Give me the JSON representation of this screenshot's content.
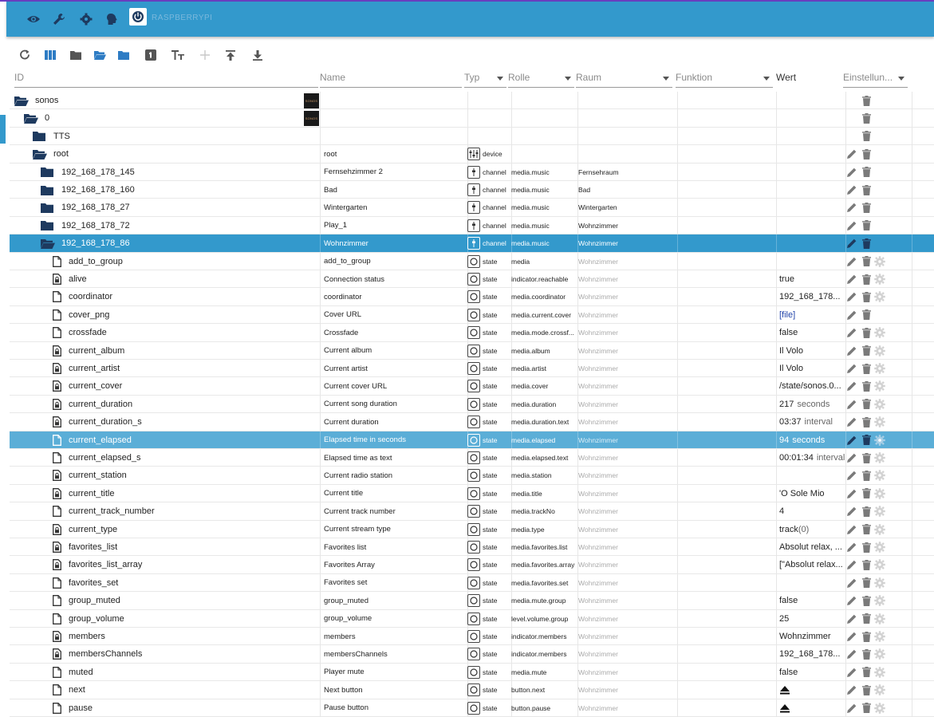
{
  "topbar": {
    "brand": "RASPBERRYPI",
    "icons": [
      "eye-icon",
      "wrench-icon",
      "gear-icon",
      "head-icon",
      "power-icon"
    ]
  },
  "toolbar": {
    "tools": [
      "refresh-icon",
      "columns-icon",
      "folder-icon",
      "folder-open-icon",
      "folder-icon",
      "number-1-icon",
      "text-size-icon",
      "plus-icon",
      "upload-icon",
      "download-icon"
    ]
  },
  "columns": {
    "id": "ID",
    "name": "Name",
    "typ": "Typ",
    "rolle": "Rolle",
    "raum": "Raum",
    "funktion": "Funktion",
    "wert": "Wert",
    "einstellungen": "Einstellun..."
  },
  "colors": {
    "topbar": "#3399cc",
    "selected": "#3399cc",
    "highlight": "#5baed7",
    "accent": "#6a3fc0"
  },
  "rows": [
    {
      "indent": 0,
      "icon": "folder-open",
      "id": "sonos",
      "name": "",
      "logo": true,
      "logo_text": "SONOS",
      "type": "",
      "type_icon": "",
      "role": "",
      "room": "",
      "wert": "",
      "actions": "d"
    },
    {
      "indent": 1,
      "icon": "folder-open",
      "id": "0",
      "name": "",
      "logo": true,
      "logo_text": "SONOS",
      "type": "",
      "type_icon": "",
      "role": "",
      "room": "",
      "wert": "",
      "actions": "d"
    },
    {
      "indent": 2,
      "icon": "folder",
      "id": "TTS",
      "name": "",
      "type": "",
      "type_icon": "",
      "role": "",
      "room": "",
      "wert": "",
      "actions": "d"
    },
    {
      "indent": 2,
      "icon": "folder-open",
      "id": "root",
      "name": "root",
      "type": "device",
      "type_icon": "device",
      "role": "",
      "room": "",
      "wert": "",
      "actions": "ed"
    },
    {
      "indent": 3,
      "icon": "folder",
      "id": "192_168_178_145",
      "name": "Fernsehzimmer 2",
      "type": "channel",
      "type_icon": "channel",
      "role": "media.music",
      "room": "Fernsehraum",
      "wert": "",
      "actions": "ed"
    },
    {
      "indent": 3,
      "icon": "folder",
      "id": "192_168_178_160",
      "name": "Bad",
      "type": "channel",
      "type_icon": "channel",
      "role": "media.music",
      "room": "Bad",
      "wert": "",
      "actions": "ed"
    },
    {
      "indent": 3,
      "icon": "folder",
      "id": "192_168_178_27",
      "name": "Wintergarten",
      "type": "channel",
      "type_icon": "channel",
      "role": "media.music",
      "room": "Wintergarten",
      "wert": "",
      "actions": "ed"
    },
    {
      "indent": 3,
      "icon": "folder",
      "id": "192_168_178_72",
      "name": "Play_1",
      "type": "channel",
      "type_icon": "channel",
      "role": "media.music",
      "room": "Wohnzimmer",
      "wert": "",
      "actions": "ed"
    },
    {
      "indent": 3,
      "icon": "folder-open",
      "id": "192_168_178_86",
      "name": "Wohnzimmer",
      "type": "channel",
      "type_icon": "channel",
      "role": "media.music",
      "room": "Wohnzimmer",
      "wert": "",
      "actions": "ed",
      "state": "sel"
    },
    {
      "indent": 4,
      "icon": "file",
      "id": "add_to_group",
      "name": "add_to_group",
      "type": "state",
      "type_icon": "state",
      "role": "media",
      "room": "Wohnzimmer",
      "room_grey": true,
      "wert": "",
      "actions": "edg"
    },
    {
      "indent": 4,
      "icon": "file-lock",
      "id": "alive",
      "name": "Connection status",
      "type": "state",
      "type_icon": "state",
      "role": "indicator.reachable",
      "room": "Wohnzimmer",
      "room_grey": true,
      "wert": "true",
      "actions": "edg"
    },
    {
      "indent": 4,
      "icon": "file",
      "id": "coordinator",
      "name": "coordinator",
      "type": "state",
      "type_icon": "state",
      "role": "media.coordinator",
      "room": "Wohnzimmer",
      "room_grey": true,
      "wert": "192_168_178...",
      "actions": "edg"
    },
    {
      "indent": 4,
      "icon": "file",
      "id": "cover_png",
      "name": "Cover URL",
      "type": "state",
      "type_icon": "state",
      "role": "media.current.cover",
      "room": "Wohnzimmer",
      "room_grey": true,
      "wert": "[file]",
      "wert_link": true,
      "actions": "ed"
    },
    {
      "indent": 4,
      "icon": "file",
      "id": "crossfade",
      "name": "Crossfade",
      "type": "state",
      "type_icon": "state",
      "role": "media.mode.crossf...",
      "room": "Wohnzimmer",
      "room_grey": true,
      "wert": "false",
      "actions": "edg"
    },
    {
      "indent": 4,
      "icon": "file-lock",
      "id": "current_album",
      "name": "Current album",
      "type": "state",
      "type_icon": "state",
      "role": "media.album",
      "room": "Wohnzimmer",
      "room_grey": true,
      "wert": "Il Volo",
      "actions": "edg"
    },
    {
      "indent": 4,
      "icon": "file-lock",
      "id": "current_artist",
      "name": "Current artist",
      "type": "state",
      "type_icon": "state",
      "role": "media.artist",
      "room": "Wohnzimmer",
      "room_grey": true,
      "wert": "Il Volo",
      "actions": "edg"
    },
    {
      "indent": 4,
      "icon": "file-lock",
      "id": "current_cover",
      "name": "Current cover URL",
      "type": "state",
      "type_icon": "state",
      "role": "media.cover",
      "room": "Wohnzimmer",
      "room_grey": true,
      "wert": "/state/sonos.0...",
      "actions": "edg"
    },
    {
      "indent": 4,
      "icon": "file-lock",
      "id": "current_duration",
      "name": "Current song duration",
      "type": "state",
      "type_icon": "state",
      "role": "media.duration",
      "room": "Wohnzimmer",
      "room_grey": true,
      "wert": "217",
      "unit": "seconds",
      "actions": "edg"
    },
    {
      "indent": 4,
      "icon": "file-lock",
      "id": "current_duration_s",
      "name": "Current duration",
      "type": "state",
      "type_icon": "state",
      "role": "media.duration.text",
      "room": "Wohnzimmer",
      "room_grey": true,
      "wert": "03:37",
      "unit": "interval",
      "actions": "edg"
    },
    {
      "indent": 4,
      "icon": "file",
      "id": "current_elapsed",
      "name": "Elapsed time in seconds",
      "type": "state",
      "type_icon": "state",
      "role": "media.elapsed",
      "room": "Wohnzimmer",
      "room_grey": true,
      "wert": "94",
      "unit": "seconds",
      "actions": "edg",
      "state": "hl"
    },
    {
      "indent": 4,
      "icon": "file",
      "id": "current_elapsed_s",
      "name": "Elapsed time as text",
      "type": "state",
      "type_icon": "state",
      "role": "media.elapsed.text",
      "room": "Wohnzimmer",
      "room_grey": true,
      "wert": "00:01:34",
      "unit": "interval",
      "actions": "edg"
    },
    {
      "indent": 4,
      "icon": "file-lock",
      "id": "current_station",
      "name": "Current radio station",
      "type": "state",
      "type_icon": "state",
      "role": "media.station",
      "room": "Wohnzimmer",
      "room_grey": true,
      "wert": "",
      "actions": "edg"
    },
    {
      "indent": 4,
      "icon": "file-lock",
      "id": "current_title",
      "name": "Current title",
      "type": "state",
      "type_icon": "state",
      "role": "media.title",
      "room": "Wohnzimmer",
      "room_grey": true,
      "wert": "'O Sole Mio",
      "actions": "edg"
    },
    {
      "indent": 4,
      "icon": "file",
      "id": "current_track_number",
      "name": "Current track number",
      "type": "state",
      "type_icon": "state",
      "role": "media.trackNo",
      "room": "Wohnzimmer",
      "room_grey": true,
      "wert": "4",
      "actions": "edg"
    },
    {
      "indent": 4,
      "icon": "file-lock",
      "id": "current_type",
      "name": "Current stream type",
      "type": "state",
      "type_icon": "state",
      "role": "media.type",
      "room": "Wohnzimmer",
      "room_grey": true,
      "wert": "track",
      "unit": "(0)",
      "unit_tight": true,
      "actions": "edg"
    },
    {
      "indent": 4,
      "icon": "file-lock",
      "id": "favorites_list",
      "name": "Favorites list",
      "type": "state",
      "type_icon": "state",
      "role": "media.favorites.list",
      "room": "Wohnzimmer",
      "room_grey": true,
      "wert": "Absolut relax, ...",
      "actions": "edg"
    },
    {
      "indent": 4,
      "icon": "file-lock",
      "id": "favorites_list_array",
      "name": "Favorites Array",
      "type": "state",
      "type_icon": "state",
      "role": "media.favorites.array",
      "room": "Wohnzimmer",
      "room_grey": true,
      "wert": "[\"Absolut relax...",
      "actions": "edg"
    },
    {
      "indent": 4,
      "icon": "file",
      "id": "favorites_set",
      "name": "Favorites set",
      "type": "state",
      "type_icon": "state",
      "role": "media.favorites.set",
      "room": "Wohnzimmer",
      "room_grey": true,
      "wert": "",
      "actions": "edg"
    },
    {
      "indent": 4,
      "icon": "file",
      "id": "group_muted",
      "name": "group_muted",
      "type": "state",
      "type_icon": "state",
      "role": "media.mute.group",
      "room": "Wohnzimmer",
      "room_grey": true,
      "wert": "false",
      "actions": "edg"
    },
    {
      "indent": 4,
      "icon": "file",
      "id": "group_volume",
      "name": "group_volume",
      "type": "state",
      "type_icon": "state",
      "role": "level.volume.group",
      "room": "Wohnzimmer",
      "room_grey": true,
      "wert": "25",
      "actions": "edg"
    },
    {
      "indent": 4,
      "icon": "file-lock",
      "id": "members",
      "name": "members",
      "type": "state",
      "type_icon": "state",
      "role": "indicator.members",
      "room": "Wohnzimmer",
      "room_grey": true,
      "wert": "Wohnzimmer",
      "actions": "edg"
    },
    {
      "indent": 4,
      "icon": "file-lock",
      "id": "membersChannels",
      "name": "membersChannels",
      "type": "state",
      "type_icon": "state",
      "role": "indicator.members",
      "room": "Wohnzimmer",
      "room_grey": true,
      "wert": "192_168_178...",
      "actions": "edg"
    },
    {
      "indent": 4,
      "icon": "file",
      "id": "muted",
      "name": "Player mute",
      "type": "state",
      "type_icon": "state",
      "role": "media.mute",
      "room": "Wohnzimmer",
      "room_grey": true,
      "wert": "false",
      "actions": "edg"
    },
    {
      "indent": 4,
      "icon": "file",
      "id": "next",
      "name": "Next button",
      "type": "state",
      "type_icon": "state",
      "role": "button.next",
      "room": "Wohnzimmer",
      "room_grey": true,
      "wert": "",
      "wert_icon": "eject-icon",
      "actions": "edg"
    },
    {
      "indent": 4,
      "icon": "file",
      "id": "pause",
      "name": "Pause button",
      "type": "state",
      "type_icon": "state",
      "role": "button.pause",
      "room": "Wohnzimmer",
      "room_grey": true,
      "wert": "",
      "wert_icon": "eject-icon",
      "actions": "edg"
    }
  ]
}
